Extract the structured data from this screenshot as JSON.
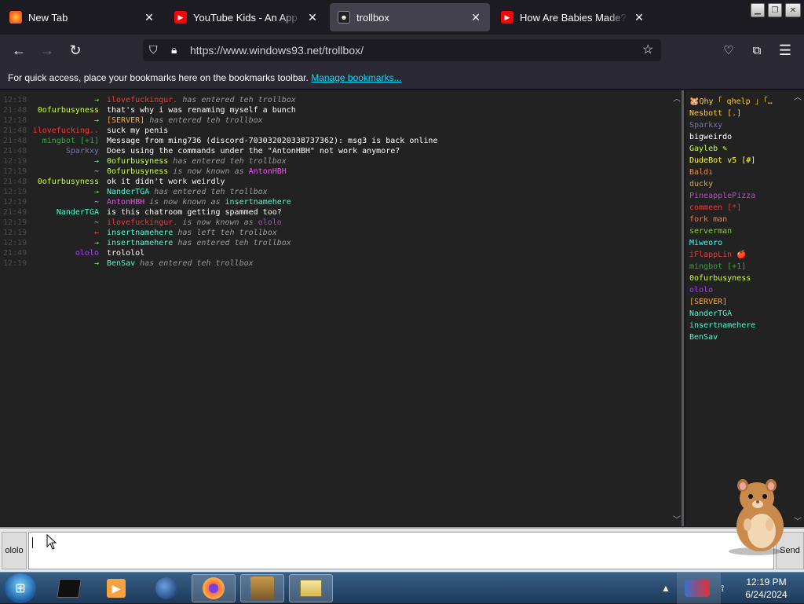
{
  "tabs": [
    {
      "title": "New Tab",
      "icon": "firefox-icon",
      "active": false
    },
    {
      "title": "YouTube Kids - An App Crea",
      "icon": "youtube-icon",
      "active": false
    },
    {
      "title": "trollbox",
      "icon": "trollbox-icon",
      "active": true
    },
    {
      "title": "How Are Babies Made? | Sm",
      "icon": "youtube-icon",
      "active": false
    }
  ],
  "nav": {
    "url": "https://www.windows93.net/trollbox/"
  },
  "bookmarks": {
    "text": "For quick access, place your bookmarks here on the bookmarks toolbar.",
    "link": "Manage bookmarks..."
  },
  "messages": [
    {
      "time": "12:18",
      "nick": "→",
      "nick_color": "#44ff44",
      "text": "ilovefuckingur. has entered teh trollbox",
      "who": "ilovefuckingur.",
      "who_color": "#ff3333",
      "rest": " has entered teh trollbox",
      "sys": true
    },
    {
      "time": "21:48",
      "nick": "0ofurbusyness",
      "nick_color": "#ccff33",
      "text": "that's why i was renaming myself a bunch",
      "sys": false
    },
    {
      "time": "12:18",
      "nick": "→",
      "nick_color": "#44ff44",
      "who": "[SERVER]",
      "who_color": "#ffaa33",
      "rest": " has entered teh trollbox",
      "sys": true
    },
    {
      "time": "21:48",
      "nick": "ilovefucking..",
      "nick_color": "#ff3333",
      "text": "suck my penis",
      "sys": false
    },
    {
      "time": "21:48",
      "nick": "mingbot [+1]",
      "nick_color": "#33aa33",
      "text": "Message from ming736 (discord-703032020338737362): msg3 is back online",
      "sys": false
    },
    {
      "time": "21:48",
      "nick": "Sparkxy",
      "nick_color": "#7777aa",
      "text": "Does using the commands under the \"AntonHBH\" not work anymore?",
      "sys": false
    },
    {
      "time": "12:19",
      "nick": "→",
      "nick_color": "#44ff44",
      "who": "0ofurbusyness",
      "who_color": "#ccff33",
      "rest": " has entered teh trollbox",
      "sys": true
    },
    {
      "time": "12:19",
      "nick": "~",
      "nick_color": "#bbbbbb",
      "who": "0ofurbusyness",
      "who_color": "#ccff33",
      "rest": " is now known as ",
      "who2": "AntonHBH",
      "who2_color": "#ff44ff",
      "sys": true
    },
    {
      "time": "21:48",
      "nick": "0ofurbusyness",
      "nick_color": "#ccff33",
      "text": "ok it didn't work weirdly",
      "sys": false
    },
    {
      "time": "12:19",
      "nick": "→",
      "nick_color": "#44ff44",
      "who": "NanderTGA",
      "who_color": "#44ffcc",
      "rest": " has entered teh trollbox",
      "sys": true
    },
    {
      "time": "12:19",
      "nick": "~",
      "nick_color": "#bbbbbb",
      "who": "AntonHBH",
      "who_color": "#ff44ff",
      "rest": " is now known as ",
      "who2": "insertnamehere",
      "who2_color": "#44ffcc",
      "sys": true
    },
    {
      "time": "21:49",
      "nick": "NanderTGA",
      "nick_color": "#44ffcc",
      "text": "is this chatroom getting spammed too?",
      "sys": false
    },
    {
      "time": "12:19",
      "nick": "~",
      "nick_color": "#bbbbbb",
      "who": "ilovefuckingur.",
      "who_color": "#ff3333",
      "rest": " is now known as ",
      "who2": "ololo",
      "who2_color": "#aa44ff",
      "sys": true
    },
    {
      "time": "12:19",
      "nick": "←",
      "nick_color": "#ff4444",
      "who": "insertnamehere",
      "who_color": "#44ffcc",
      "rest": " has left teh trollbox",
      "sys": true
    },
    {
      "time": "12:19",
      "nick": "→",
      "nick_color": "#44ff44",
      "who": "insertnamehere",
      "who_color": "#44ffcc",
      "rest": " has entered teh trollbox",
      "sys": true
    },
    {
      "time": "21:49",
      "nick": "ololo",
      "nick_color": "#aa44ff",
      "text": "trololol",
      "sys": false
    },
    {
      "time": "12:19",
      "nick": "→",
      "nick_color": "#44ff44",
      "who": "BenSav",
      "who_color": "#44ffcc",
      "rest": " has entered teh trollbox",
      "sys": true
    }
  ],
  "users": [
    {
      "name": "🐹Qhy ｢ qhelp ｣ ｢…",
      "color": "#ffcc33"
    },
    {
      "name": "Nesbott [.]",
      "color": "#ffcc33"
    },
    {
      "name": "Sparkxy",
      "color": "#7777aa"
    },
    {
      "name": "bigweirdo",
      "color": "#ffffff"
    },
    {
      "name": "Gayleb ✎",
      "color": "#ccff33"
    },
    {
      "name": "DudeBot v5 [#]",
      "color": "#ffff33"
    },
    {
      "name": "Baldı",
      "color": "#ff8833"
    },
    {
      "name": "ducky",
      "color": "#ccaa66"
    },
    {
      "name": "PineapplePizza",
      "color": "#cc44cc"
    },
    {
      "name": "commeen [*]",
      "color": "#ff3333"
    },
    {
      "name": "fork man",
      "color": "#ff7744"
    },
    {
      "name": "serverman",
      "color": "#88cc33"
    },
    {
      "name": "Miweoro",
      "color": "#33ffff"
    },
    {
      "name": "iFlappLin 🍎",
      "color": "#ff3333"
    },
    {
      "name": "mingbot [+1]",
      "color": "#33aa33"
    },
    {
      "name": "0ofurbusyness",
      "color": "#ccff33"
    },
    {
      "name": "ololo",
      "color": "#aa44ff"
    },
    {
      "name": "[SERVER]",
      "color": "#ffaa33"
    },
    {
      "name": "NanderTGA",
      "color": "#44ffcc"
    },
    {
      "name": "insertnamehere",
      "color": "#44ffcc"
    },
    {
      "name": "BenSav",
      "color": "#44ffcc"
    }
  ],
  "input": {
    "nick_label": "ololo",
    "value": "",
    "send_label": "Send"
  },
  "taskbar": {
    "time": "12:19 PM",
    "date": "6/24/2024"
  }
}
